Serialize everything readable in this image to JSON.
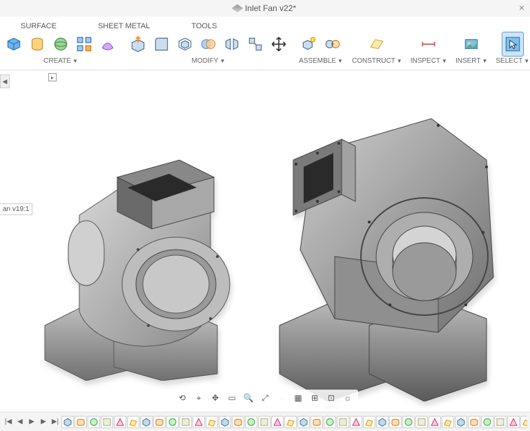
{
  "title": "Inlet Fan v22*",
  "close_glyph": "×",
  "tabs": {
    "surface": "SURFACE",
    "sheetmetal": "SHEET METAL",
    "tools": "TOOLS"
  },
  "toolbar_groups": {
    "create": "CREATE",
    "modify": "MODIFY",
    "assemble": "ASSEMBLE",
    "construct": "CONSTRUCT",
    "inspect": "INSPECT",
    "insert": "INSERT",
    "select": "SELECT"
  },
  "caret": "▼",
  "browser_tag": "an v19:1",
  "nav": {
    "orbit": "⟲",
    "look": "⌖",
    "pan": "✥",
    "zoom_window": "▭",
    "zoom": "🔍",
    "fit": "⤢",
    "display": "▦",
    "grid": "⊞",
    "snap": "⊡",
    "effects": "☼"
  },
  "timeline_controls": {
    "start": "|◀",
    "prev": "◀",
    "play": "▶",
    "next": "▶",
    "end": "▶|"
  },
  "timeline_count": 40,
  "icon_colors": {
    "blue": "#4a90d9",
    "cyan": "#5bc0de",
    "orange": "#f0ad4e",
    "green": "#5cb85c",
    "purple": "#b57edc",
    "gray": "#aab"
  }
}
